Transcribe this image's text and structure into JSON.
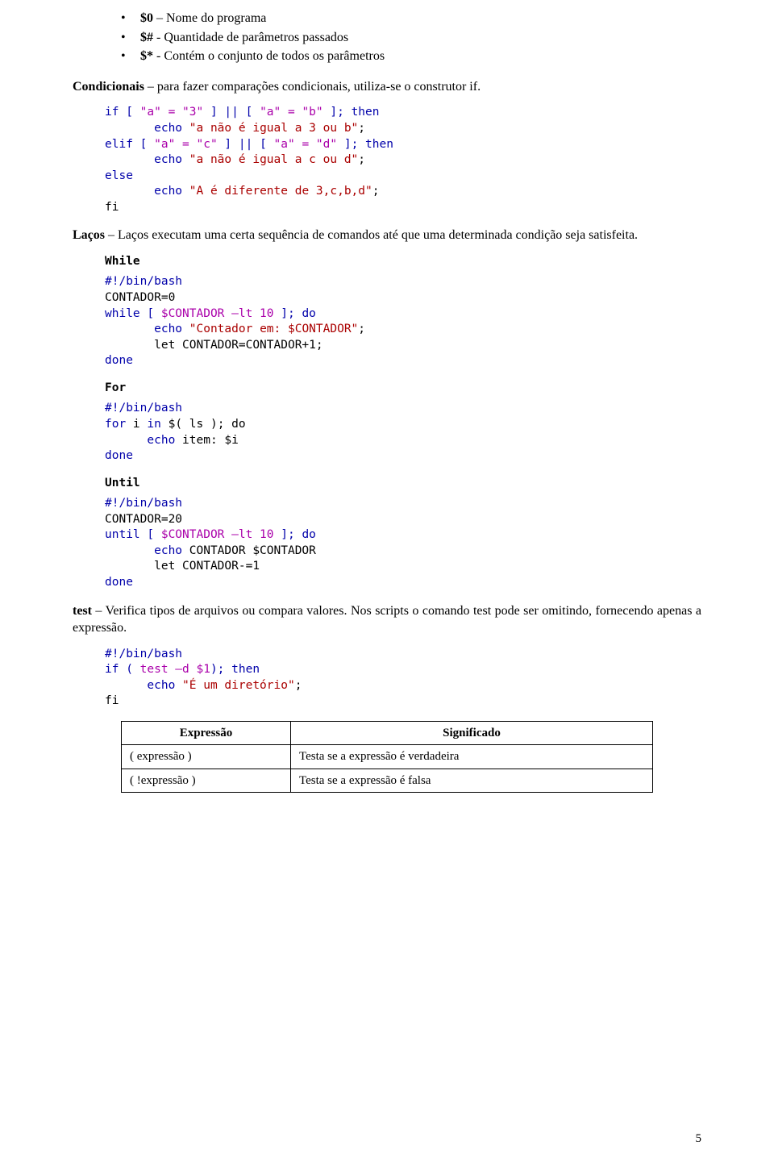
{
  "bullets": [
    {
      "var": "$0",
      "text": "– Nome do programa"
    },
    {
      "var": "$#",
      "text": "- Quantidade de parâmetros passados"
    },
    {
      "var": "$*",
      "text": "- Contém o conjunto de todos os parâmetros"
    }
  ],
  "cond_para": {
    "bold": "Condicionais",
    "rest": " – para fazer comparações condicionais, utiliza-se o construtor if."
  },
  "code_if": {
    "l1a": "if [ ",
    "l1b": "\"a\" = \"3\"",
    "l1c": " ] || [ ",
    "l1d": "\"a\" = \"b\"",
    "l1e": " ]; ",
    "l1f": "then",
    "l2a": "       echo ",
    "l2b": "\"a não é igual a 3 ou b\"",
    "l2c": ";",
    "l3a": "elif [ ",
    "l3b": "\"a\" = \"c\"",
    "l3c": " ] || [ ",
    "l3d": "\"a\" = \"d\"",
    "l3e": " ]; ",
    "l3f": "then",
    "l4a": "       echo ",
    "l4b": "\"a não é igual a c ou d\"",
    "l4c": ";",
    "l5": "else",
    "l6a": "       echo ",
    "l6b": "\"A é diferente de 3,c,b,d\"",
    "l6c": ";",
    "l7": "fi"
  },
  "lacos_para": {
    "bold": "Laços",
    "rest": " – Laços executam uma certa sequência de comandos até que uma determinada condição seja satisfeita."
  },
  "labels": {
    "while": "While",
    "for": "For",
    "until": "Until"
  },
  "code_while": {
    "l1": "#!/bin/bash",
    "l2": "CONTADOR=0  ",
    "l3a": "while [ ",
    "l3b": "$CONTADOR –lt 10",
    "l3c": " ]; do",
    "l4a": "       echo ",
    "l4b": "\"Contador em: $CONTADOR\"",
    "l4c": ";",
    "l5": "       let CONTADOR=CONTADOR+1;",
    "l6": "done  "
  },
  "code_for": {
    "l1": "#!/bin/bash",
    "l2a": "for",
    "l2b": " i ",
    "l2c": "in",
    "l2d": " $( ls ); do",
    "l3a": "      echo",
    "l3b": " item: $i",
    "l4": "done"
  },
  "code_until": {
    "l1": "#!/bin/bash",
    "l2": "CONTADOR=20  ",
    "l3a": "until [ ",
    "l3b": "$CONTADOR –lt 10",
    "l3c": " ]; do",
    "l4a": "       echo",
    "l4b": " CONTADOR $CONTADOR",
    "l5": "       let CONTADOR-=1",
    "l6": "done  "
  },
  "test_para": {
    "bold": "test",
    "rest": " – Verifica tipos de arquivos ou compara valores. Nos scripts o comando test pode ser omitindo, fornecendo apenas a expressão."
  },
  "code_test": {
    "l1": "#!/bin/bash",
    "l2a": "if (",
    "l2b": " test –d $1",
    "l2c": "); ",
    "l2d": "then",
    "l3a": "      echo ",
    "l3b": "\"É um diretório\"",
    "l3c": ";",
    "l4": "fi"
  },
  "table": {
    "h1": "Expressão",
    "h2": "Significado",
    "r1c1": "( expressão )",
    "r1c2": "Testa se a expressão é verdadeira",
    "r2c1": "( !expressão )",
    "r2c2": "Testa se a expressão é falsa"
  },
  "page_number": "5"
}
